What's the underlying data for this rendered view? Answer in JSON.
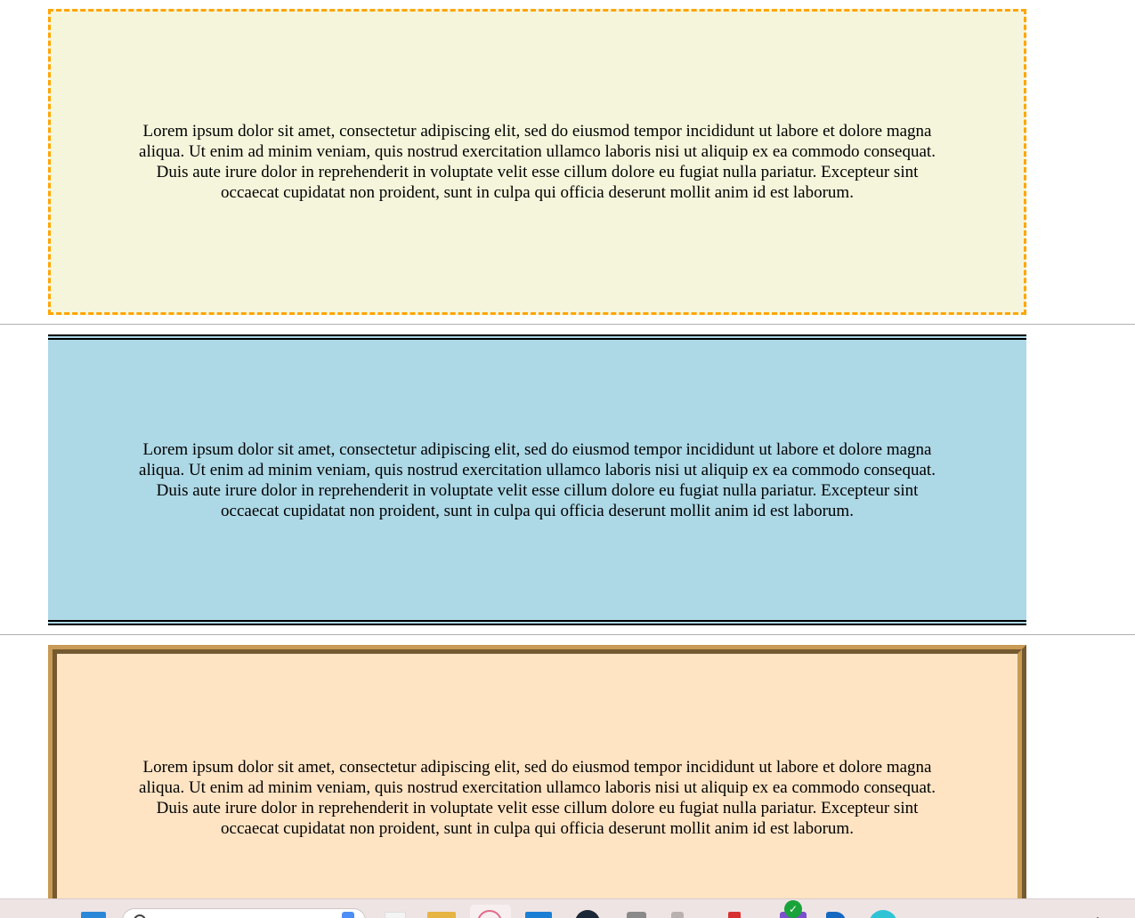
{
  "boxes": {
    "dashed_text": "Lorem ipsum dolor sit amet, consectetur adipiscing elit, sed do eiusmod tempor incididunt ut labore et dolore magna aliqua. Ut enim ad minim veniam, quis nostrud exercitation ullamco laboris nisi ut aliquip ex ea commodo consequat. Duis aute irure dolor in reprehenderit in voluptate velit esse cillum dolore eu fugiat nulla pariatur. Excepteur sint occaecat cupidatat non proident, sunt in culpa qui officia deserunt mollit anim id est laborum.",
    "double_text": "Lorem ipsum dolor sit amet, consectetur adipiscing elit, sed do eiusmod tempor incididunt ut labore et dolore magna aliqua. Ut enim ad minim veniam, quis nostrud exercitation ullamco laboris nisi ut aliquip ex ea commodo consequat. Duis aute irure dolor in reprehenderit in voluptate velit esse cillum dolore eu fugiat nulla pariatur. Excepteur sint occaecat cupidatat non proident, sunt in culpa qui officia deserunt mollit anim id est laborum.",
    "ridge_text": "Lorem ipsum dolor sit amet, consectetur adipiscing elit, sed do eiusmod tempor incididunt ut labore et dolore magna aliqua. Ut enim ad minim veniam, quis nostrud exercitation ullamco laboris nisi ut aliquip ex ea commodo consequat. Duis aute irure dolor in reprehenderit in voluptate velit esse cillum dolore eu fugiat nulla pariatur. Excepteur sint occaecat cupidatat non proident, sunt in culpa qui officia deserunt mollit anim id est laborum."
  },
  "colors": {
    "dashed_background": "#f5f5dc",
    "dashed_border": "#ffa500",
    "double_background": "#add8e6",
    "double_border": "#000000",
    "ridge_background": "#ffe4c4",
    "ridge_border": "#c89a55"
  },
  "taskbar": {
    "icons": [
      "windows-start-icon",
      "search-icon",
      "copilot-icon",
      "file-icon",
      "folder-icon",
      "chrome-icon",
      "store-icon",
      "steam-icon",
      "game-icon",
      "app-icon",
      "red-app-icon",
      "purple-app-icon",
      "edge-icon",
      "cyan-app-icon",
      "chevron-up-icon"
    ],
    "badge": "✓",
    "chevron": "⌃"
  }
}
